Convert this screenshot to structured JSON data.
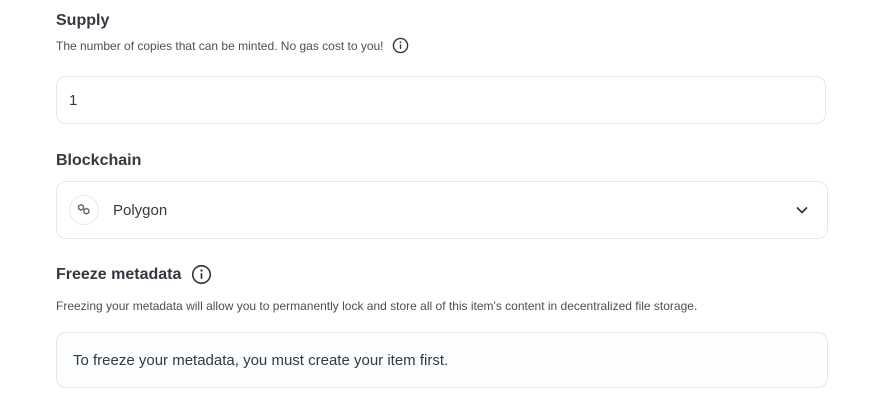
{
  "supply": {
    "title": "Supply",
    "help_text": "The number of copies that can be minted. No gas cost to you!",
    "value": "1"
  },
  "blockchain": {
    "title": "Blockchain",
    "selected": "Polygon"
  },
  "freeze": {
    "title": "Freeze metadata",
    "help_text": "Freezing your metadata will allow you to permanently lock and store all of this item's content in decentralized file storage.",
    "notice": "To freeze your metadata, you must create your item first."
  },
  "icons": {
    "info": "info-icon",
    "chain_logo": "polygon-icon",
    "chevron": "chevron-down-icon"
  },
  "colors": {
    "text": "#353840",
    "border": "#e5e8eb",
    "notice_bg": "#fbfdff"
  }
}
